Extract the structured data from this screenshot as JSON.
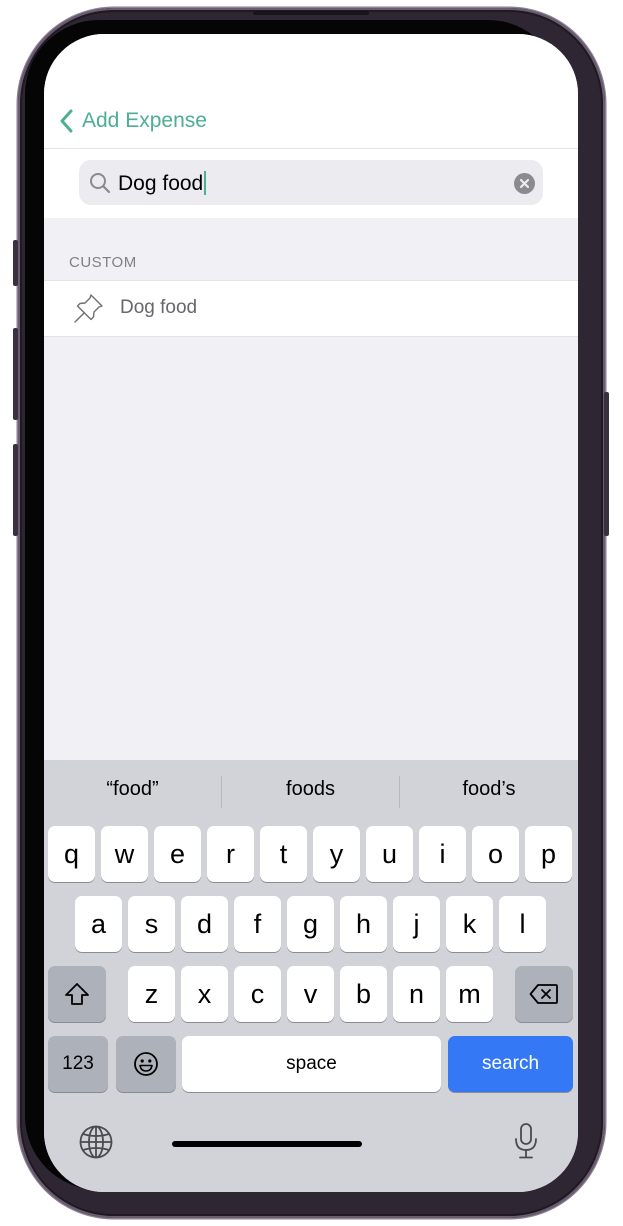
{
  "nav": {
    "back_label": "Add Expense"
  },
  "search": {
    "value": "Dog food",
    "icon": "magnifying-glass-icon",
    "clear_icon": "clear-x-circle-icon"
  },
  "results": {
    "section_header": "CUSTOM",
    "items": [
      {
        "label": "Dog food",
        "icon": "pin-icon"
      }
    ]
  },
  "keyboard": {
    "suggestions": [
      "“food”",
      "foods",
      "food’s"
    ],
    "row1": [
      "q",
      "w",
      "e",
      "r",
      "t",
      "y",
      "u",
      "i",
      "o",
      "p"
    ],
    "row2": [
      "a",
      "s",
      "d",
      "f",
      "g",
      "h",
      "j",
      "k",
      "l"
    ],
    "row3": [
      "z",
      "x",
      "c",
      "v",
      "b",
      "n",
      "m"
    ],
    "numbers_label": "123",
    "space_label": "space",
    "action_label": "search",
    "action_color": "#3478f6"
  },
  "colors": {
    "accent": "#4caf91",
    "background": "#f0f0f5"
  }
}
